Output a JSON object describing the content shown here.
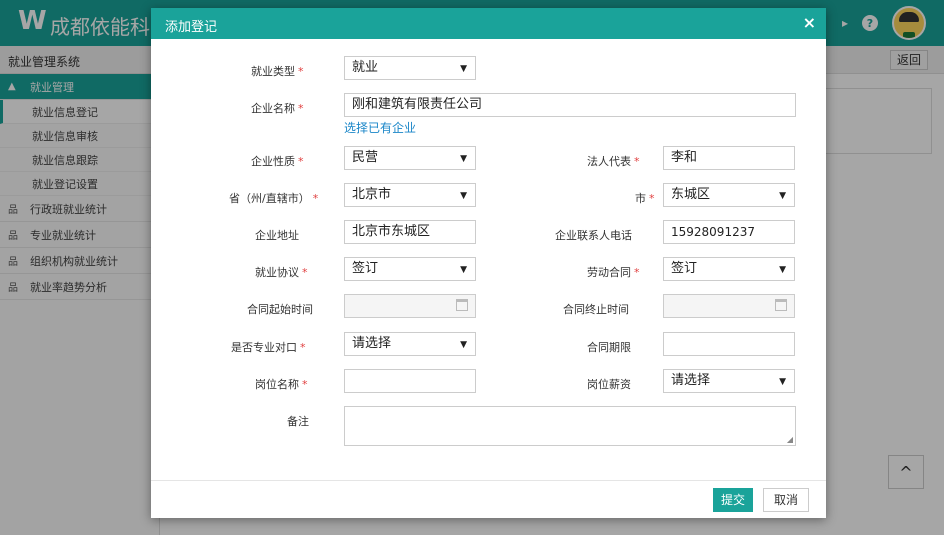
{
  "app": {
    "logo_char": "W",
    "brand": "成都依能科",
    "system_title": "就业管理系统",
    "back_label": "返回",
    "help_icon_glyph": "?",
    "up_glyph": "^"
  },
  "sidebar": {
    "groups": [
      {
        "label": "就业管理",
        "icon": "grad-cap-icon",
        "active": true,
        "items": [
          "就业信息登记",
          "就业信息审核",
          "就业信息跟踪",
          "就业登记设置"
        ]
      },
      {
        "label": "行政班就业统计",
        "icon": "org-chart-icon"
      },
      {
        "label": "专业就业统计",
        "icon": "org-chart-icon"
      },
      {
        "label": "组织机构就业统计",
        "icon": "org-chart-icon"
      },
      {
        "label": "就业率趋势分析",
        "icon": "org-chart-icon"
      }
    ]
  },
  "modal": {
    "title": "添加登记",
    "close_glyph": "×",
    "fields": {
      "employment_type": {
        "label": "就业类型",
        "value": "就业"
      },
      "company_name": {
        "label": "企业名称",
        "value": "刚和建筑有限责任公司",
        "link": "选择已有企业"
      },
      "company_nature": {
        "label": "企业性质",
        "value": "民营"
      },
      "legal_rep": {
        "label": "法人代表",
        "value": "李和"
      },
      "province": {
        "label": "省（州/直辖市）",
        "value": "北京市"
      },
      "city": {
        "label": "市",
        "value": "东城区"
      },
      "address": {
        "label": "企业地址",
        "value": "北京市东城区"
      },
      "contact_phone": {
        "label": "企业联系人电话",
        "value": "15928091237"
      },
      "employment_agreement": {
        "label": "就业协议",
        "value": "签订"
      },
      "labor_contract": {
        "label": "劳动合同",
        "value": "签订"
      },
      "contract_start": {
        "label": "合同起始时间",
        "value": ""
      },
      "contract_end": {
        "label": "合同终止时间",
        "value": ""
      },
      "major_match": {
        "label": "是否专业对口",
        "value": "请选择"
      },
      "contract_term": {
        "label": "合同期限",
        "value": ""
      },
      "position_name": {
        "label": "岗位名称",
        "value": ""
      },
      "position_salary": {
        "label": "岗位薪资",
        "value": "请选择"
      },
      "remark": {
        "label": "备注",
        "value": ""
      }
    },
    "required_mark": "*",
    "submit_label": "提交",
    "cancel_label": "取消"
  },
  "colors": {
    "accent": "#1aa39a",
    "required": "#e04040",
    "link": "#1a86c8"
  }
}
